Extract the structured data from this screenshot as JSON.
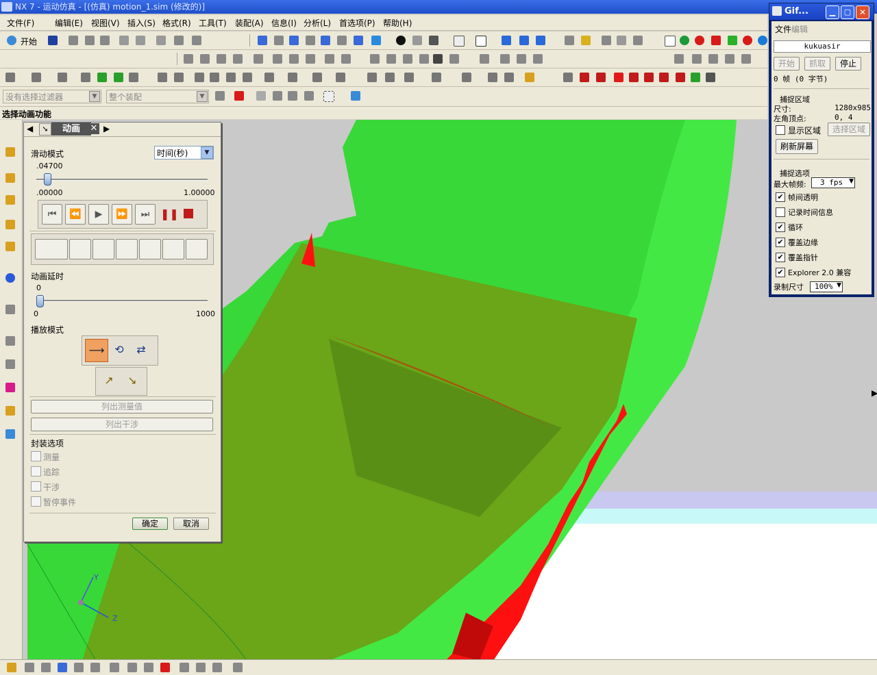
{
  "window": {
    "title": "NX 7 - 运动仿真 - [(仿真) motion_1.sim (修改的)]"
  },
  "menu": [
    "文件(F)",
    "编辑(E)",
    "视图(V)",
    "插入(S)",
    "格式(R)",
    "工具(T)",
    "装配(A)",
    "信息(I)",
    "分析(L)",
    "首选项(P)",
    "帮助(H)"
  ],
  "toolbar": {
    "start_label": "开始",
    "filter_placeholder": "没有选择过滤器",
    "scope_placeholder": "整个装配"
  },
  "cue_line": "选择动画功能",
  "dialog": {
    "title": "动画",
    "slide_mode_label": "滑动模式",
    "slide_mode_value": "时间(秒)",
    "time_value": ".04700",
    "time_fraction": 0.047,
    "time_min": ".00000",
    "time_max": "1.00000",
    "delay_label": "动画延时",
    "delay_value": "0",
    "delay_min": "0",
    "delay_max": "1000",
    "play_mode_label": "播放模式",
    "list_measure_label": "列出测量值",
    "list_interference_label": "列出干涉",
    "packaging_label": "封装选项",
    "packaging_options": [
      "测量",
      "追踪",
      "干涉",
      "暂停事件"
    ],
    "ok_label": "确定",
    "cancel_label": "取消"
  },
  "gif": {
    "title": "Gif...",
    "menu_file": "文件",
    "menu_edit": "编辑",
    "name": "kukuasir",
    "start_label": "开始",
    "capture_label": "抓取",
    "stop_label": "停止",
    "frames_text": "0 帧 (0 字节)",
    "capture_area_label": "捕捉区域",
    "size_label": "尺寸:",
    "size_value": "1280x985",
    "corner_label": "左角顶点:",
    "corner_value": "0, 4",
    "show_area_label": "显示区域",
    "select_area_label": "选择区域",
    "refresh_label": "刷新屏幕",
    "capture_options_label": "捕捉选项",
    "max_fps_label": "最大帧频:",
    "max_fps_value": "3 fps",
    "options": [
      {
        "label": "帧间透明",
        "checked": true
      },
      {
        "label": "记录时间信息",
        "checked": false
      },
      {
        "label": "循环",
        "checked": true
      },
      {
        "label": "覆盖边缘",
        "checked": true
      },
      {
        "label": "覆盖指针",
        "checked": true
      },
      {
        "label": "Explorer 2.0 兼容",
        "checked": true
      }
    ],
    "record_size_label": "录制尺寸",
    "record_size_value": "100%"
  },
  "axes": {
    "y": "Y",
    "z": "Z"
  },
  "colors": {
    "green_light": "#44e844",
    "green_dark": "#1e9a1e",
    "olive": "#6a8f1c",
    "red": "#ff1010",
    "background": "#c9c9c9"
  }
}
